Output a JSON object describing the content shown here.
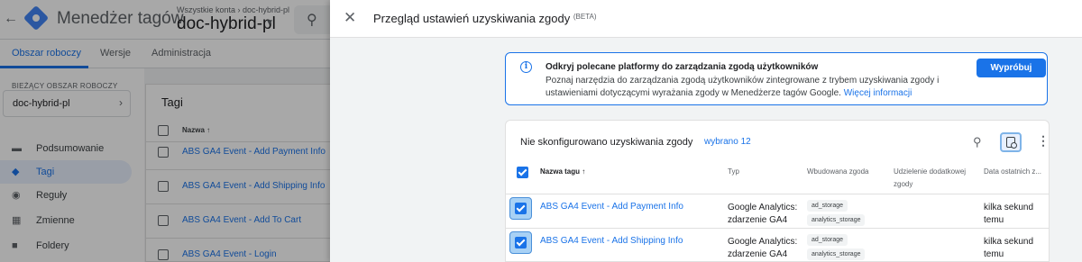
{
  "app": {
    "title": "Menedżer tagów",
    "account_crumb": "Wszystkie konta › doc-hybrid-pl",
    "container_name": "doc-hybrid-pl"
  },
  "nav_tabs": [
    {
      "label": "Obszar roboczy",
      "active": true
    },
    {
      "label": "Wersje",
      "active": false
    },
    {
      "label": "Administracja",
      "active": false
    }
  ],
  "sidebar": {
    "workspace_label": "BIEŻĄCY OBSZAR ROBOCZY",
    "workspace_name": "doc-hybrid-pl",
    "items": [
      {
        "label": "Podsumowanie",
        "icon": "summary-icon",
        "active": false
      },
      {
        "label": "Tagi",
        "icon": "tag-icon",
        "active": true
      },
      {
        "label": "Reguły",
        "icon": "trigger-icon",
        "active": false
      },
      {
        "label": "Zmienne",
        "icon": "variables-icon",
        "active": false
      },
      {
        "label": "Foldery",
        "icon": "folder-icon",
        "active": false
      }
    ]
  },
  "tags_card": {
    "title": "Tagi",
    "column_name": "Nazwa ↑",
    "rows": [
      "ABS GA4 Event - Add Payment Info",
      "ABS GA4 Event - Add Shipping Info",
      "ABS GA4 Event - Add To Cart",
      "ABS GA4 Event - Login"
    ]
  },
  "panel": {
    "title": "Przegląd ustawień uzyskiwania zgody",
    "beta": "(BETA)",
    "banner": {
      "title": "Odkryj polecane platformy do zarządzania zgodą użytkowników",
      "body": "Poznaj narzędzia do zarządzania zgodą użytkowników zintegrowane z trybem uzyskiwania zgody i ustawieniami dotyczącymi wyrażania zgody w Menedżerze tagów Google.",
      "link": "Więcej informacji",
      "button": "Wypróbuj"
    },
    "table": {
      "filter_title": "Nie skonfigurowano uzyskiwania zgody",
      "selected_count": "wybrano 12",
      "columns": {
        "name": "Nazwa tagu ↑",
        "type": "Typ",
        "builtin": "Wbudowana zgoda",
        "additional": "Udzielenie dodatkowej zgody",
        "date": "Data ostatnich z..."
      },
      "rows": [
        {
          "name": "ABS GA4 Event - Add Payment Info",
          "type_line1": "Google Analytics:",
          "type_line2": "zdarzenie GA4",
          "consents": [
            "ad_storage",
            "analytics_storage"
          ],
          "date_line1": "kilka sekund",
          "date_line2": "temu"
        },
        {
          "name": "ABS GA4 Event - Add Shipping Info",
          "type_line1": "Google Analytics:",
          "type_line2": "zdarzenie GA4",
          "consents": [
            "ad_storage",
            "analytics_storage"
          ],
          "date_line1": "kilka sekund",
          "date_line2": "temu"
        }
      ]
    }
  },
  "colors": {
    "accent": "#1a73e8",
    "overlay": "rgba(0,0,0,0.34)",
    "panel_bg": "#f1f3f4"
  }
}
